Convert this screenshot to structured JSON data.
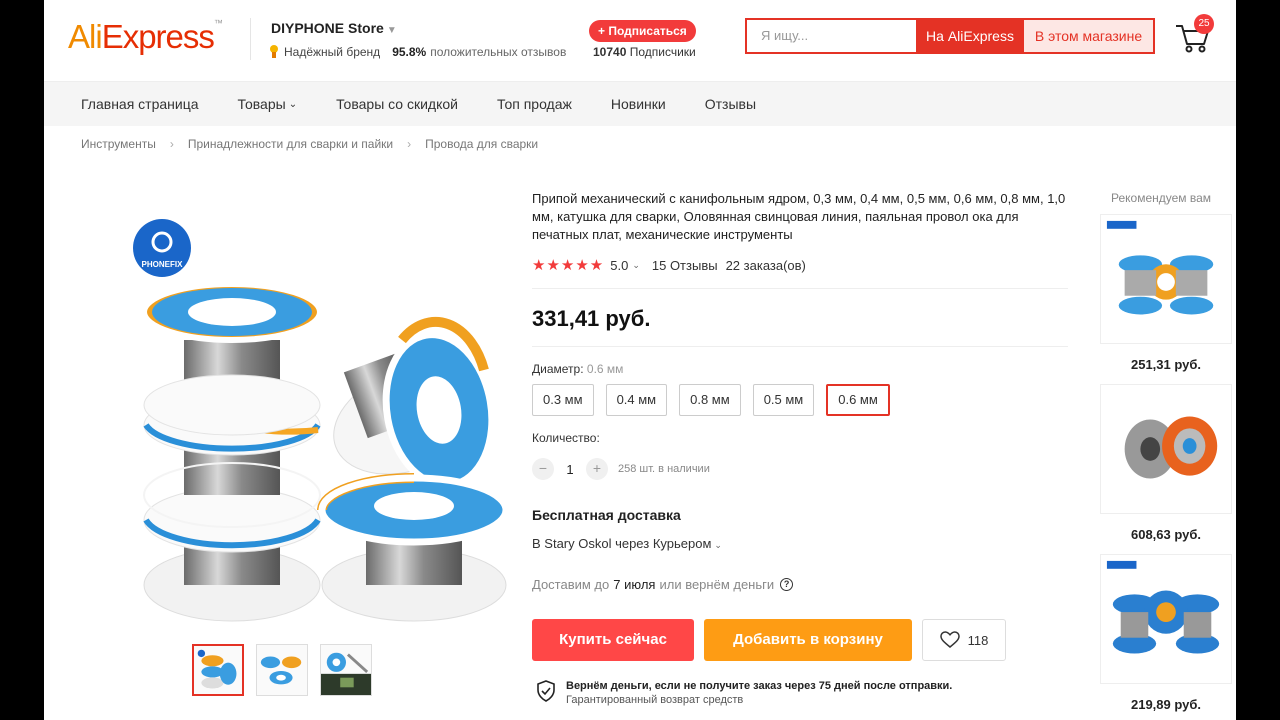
{
  "header": {
    "logo_ali": "Ali",
    "logo_express": "Express",
    "store_name": "DIYPHONE Store",
    "brand_badge": "Надёжный бренд",
    "positive_pct": "95.8%",
    "positive_label": "положительных отзывов",
    "subscribe_label": "+ Подписаться",
    "subscribers_count": "10740",
    "subscribers_label": "Подписчики",
    "search_placeholder": "Я ищу...",
    "search_btn_ali": "На AliExpress",
    "search_btn_store": "В этом магазине",
    "cart_count": "25"
  },
  "nav": {
    "items": [
      "Главная страница",
      "Товары",
      "Товары со скидкой",
      "Топ продаж",
      "Новинки",
      "Отзывы"
    ]
  },
  "breadcrumb": [
    "Инструменты",
    "Принадлежности для сварки и пайки",
    "Провода для сварки"
  ],
  "product": {
    "brand_logo_text": "PHONEFIX",
    "title": "Припой механический с канифольным ядром, 0,3 мм, 0,4 мм, 0,5 мм, 0,6 мм, 0,8 мм, 1,0 мм, катушка для сварки, Оловянная свинцовая линия, паяльная провол ока для печатных плат, механические инструменты",
    "stars": "★★★★★",
    "rating": "5.0",
    "reviews": "15 Отзывы",
    "orders": "22 заказа(ов)",
    "price": "331,41 руб.",
    "diameter_label": "Диаметр:",
    "diameter_selected": "0.6 мм",
    "variants": [
      "0.3 мм",
      "0.4 мм",
      "0.8 мм",
      "0.5 мм",
      "0.6 мм"
    ],
    "quantity_label": "Количество:",
    "quantity": "1",
    "stock": "258 шт. в наличии",
    "shipping_title": "Бесплатная доставка",
    "shipping_to": "В Stary Oskol через Курьером",
    "deliver_prefix": "Доставим до",
    "deliver_date": "7 июля",
    "deliver_suffix": "или вернём деньги",
    "buy_now": "Купить сейчас",
    "add_to_cart": "Добавить в корзину",
    "wishlist_count": "118",
    "guarantee_title": "Вернём деньги, если не получите заказ через 75 дней после отправки.",
    "guarantee_sub": "Гарантированный возврат средств"
  },
  "recommended": {
    "title": "Рекомендуем вам",
    "items": [
      {
        "price": "251,31 руб."
      },
      {
        "price": "608,63 руб."
      },
      {
        "price": "219,89 руб."
      }
    ]
  },
  "colors": {
    "brand_red": "#e43225",
    "buy_red": "#ff4747",
    "cart_orange": "#fe9c14",
    "star_red": "#f23b3b"
  }
}
